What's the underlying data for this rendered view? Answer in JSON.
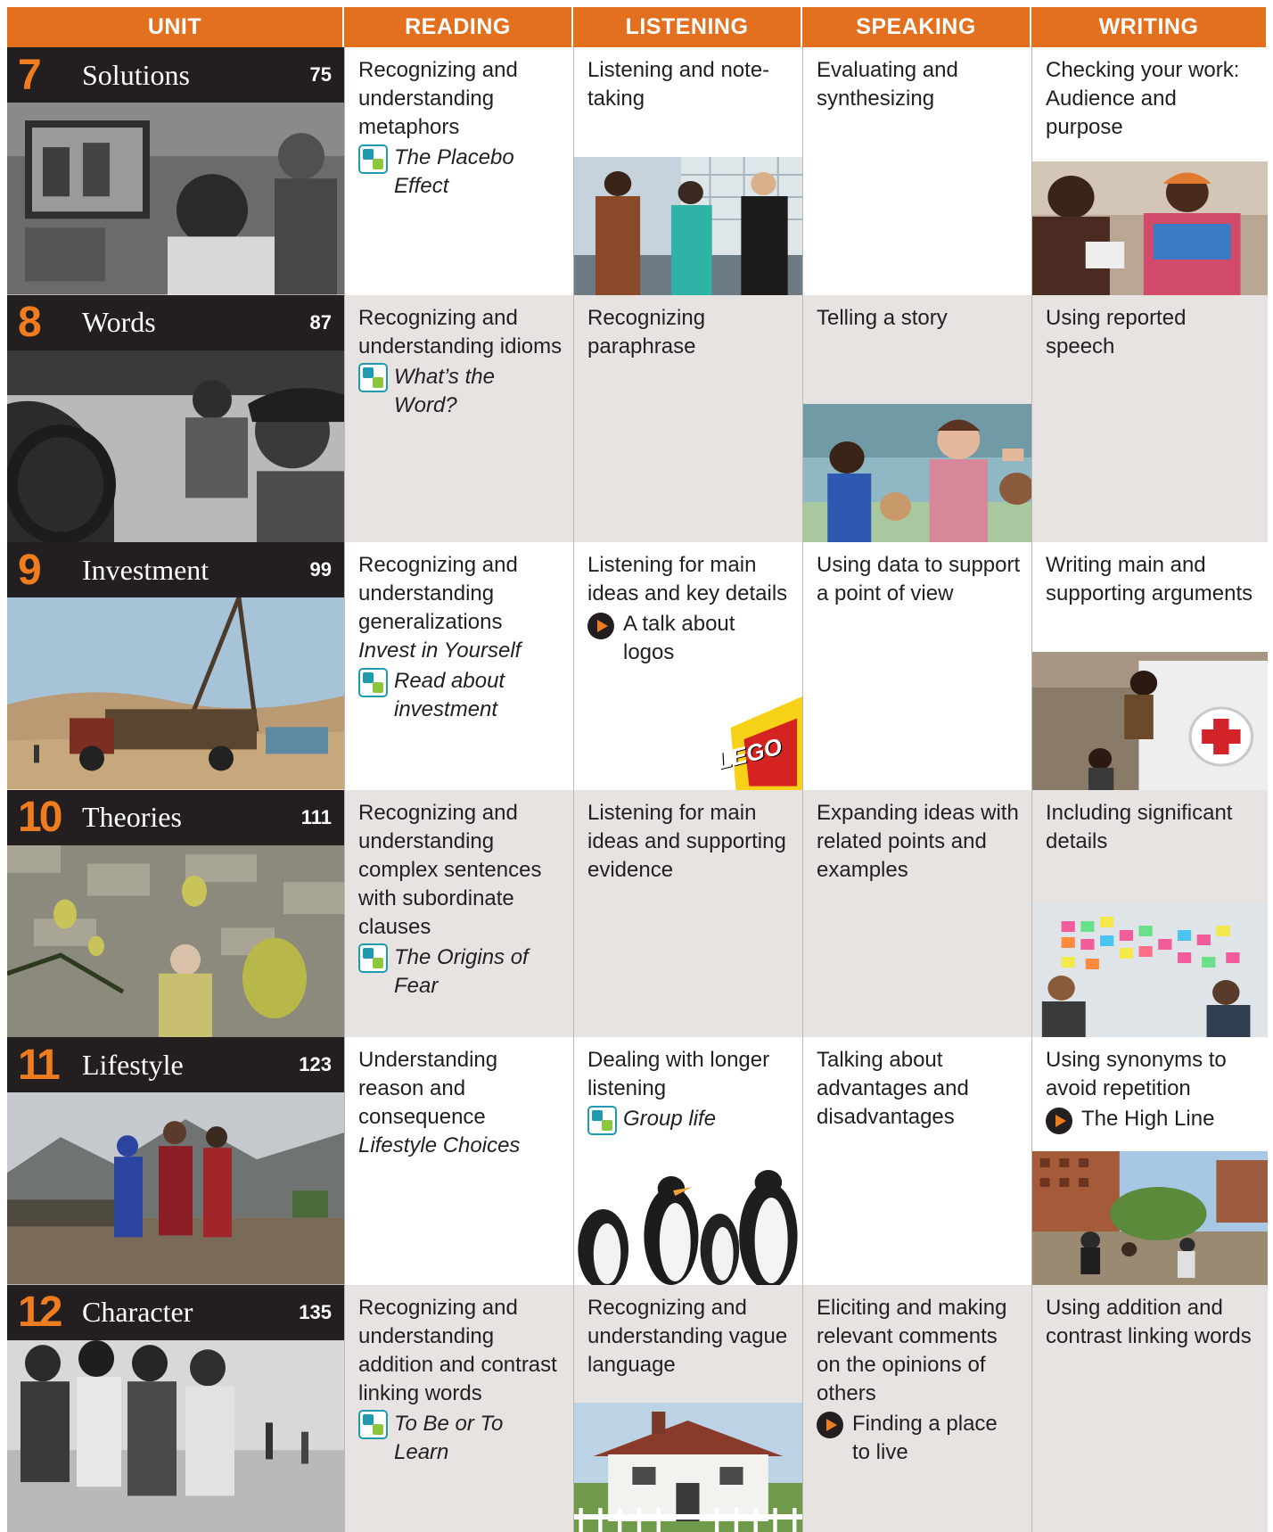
{
  "headers": [
    "UNIT",
    "READING",
    "LISTENING",
    "SPEAKING",
    "WRITING"
  ],
  "units": [
    {
      "number": "7",
      "name": "Solutions",
      "page": "75",
      "photo": "barber-shop-photo",
      "reading": {
        "text": "Recognizing and understanding metaphors",
        "resource_icon": "qr-icon",
        "resource": "The Placebo Effect"
      },
      "listening": {
        "text": "Listening and note-taking",
        "photo": "interview-photo"
      },
      "speaking": {
        "text": "Evaluating and synthesizing"
      },
      "writing": {
        "text": "Checking your work: Audience and purpose",
        "photo": "women-talking-photo"
      }
    },
    {
      "number": "8",
      "name": "Words",
      "page": "87",
      "photo": "car-conversation-photo",
      "reading": {
        "text": "Recognizing and understanding idioms",
        "resource_icon": "qr-icon",
        "resource": "What’s the Word?"
      },
      "listening": {
        "text": "Recognizing paraphrase"
      },
      "speaking": {
        "text": "Telling a story",
        "photo": "storytelling-photo"
      },
      "writing": {
        "text": "Using reported speech"
      }
    },
    {
      "number": "9",
      "name": "Investment",
      "page": "99",
      "photo": "drilling-rig-photo",
      "reading": {
        "text": "Recognizing and understanding generalizations",
        "italic": "Invest in Yourself",
        "resource_icon": "qr-icon",
        "resource": "Read about investment"
      },
      "listening": {
        "text": "Listening for main ideas and key details",
        "resource_icon": "play-icon",
        "resource": "A talk about logos",
        "photo": "lego-logo-photo",
        "photo_text": "LEGO"
      },
      "speaking": {
        "text": "Using data to support a point of view"
      },
      "writing": {
        "text": "Writing main and supporting arguments",
        "photo": "red-cross-van-photo"
      }
    },
    {
      "number": "10",
      "name": "Theories",
      "page": "111",
      "photo": "lemon-tree-photo",
      "reading": {
        "text": "Recognizing and understanding complex sentences with subordinate clauses",
        "resource_icon": "qr-icon",
        "resource": "The Origins of Fear"
      },
      "listening": {
        "text": "Listening for main ideas and supporting evidence"
      },
      "speaking": {
        "text": "Expanding ideas with related points and examples"
      },
      "writing": {
        "text": "Including significant details",
        "photo": "sticky-notes-photo"
      }
    },
    {
      "number": "11",
      "name": "Lifestyle",
      "page": "123",
      "photo": "family-photo",
      "reading": {
        "text": "Understanding reason and consequence",
        "italic": "Lifestyle Choices"
      },
      "listening": {
        "text": "Dealing with longer listening",
        "resource_icon": "qr-icon",
        "resource": "Group life",
        "photo": "penguins-photo"
      },
      "speaking": {
        "text": "Talking about advantages and disadvantages"
      },
      "writing": {
        "text": "Using synonyms to avoid repetition",
        "resource_icon": "play-icon",
        "resource": "The High Line",
        "photo": "high-line-photo"
      }
    },
    {
      "number": "12",
      "name": "Character",
      "page": "135",
      "photo": "friends-walking-photo",
      "reading": {
        "text": "Recognizing and understanding addition and contrast linking words",
        "resource_icon": "qr-icon",
        "resource": "To Be or To Learn"
      },
      "listening": {
        "text": "Recognizing and understanding vague language",
        "photo": "cottage-photo"
      },
      "speaking": {
        "text": "Eliciting and making relevant comments on the opinions of others",
        "resource_icon": "play-icon",
        "resource": "Finding a place to live"
      },
      "writing": {
        "text": "Using addition and contrast linking words"
      }
    }
  ],
  "colors": {
    "header_orange": "#e2701f",
    "unit_number_orange": "#ef7c1e",
    "unit_bar": "#231f20",
    "row_grey": "#e6e3e1"
  }
}
